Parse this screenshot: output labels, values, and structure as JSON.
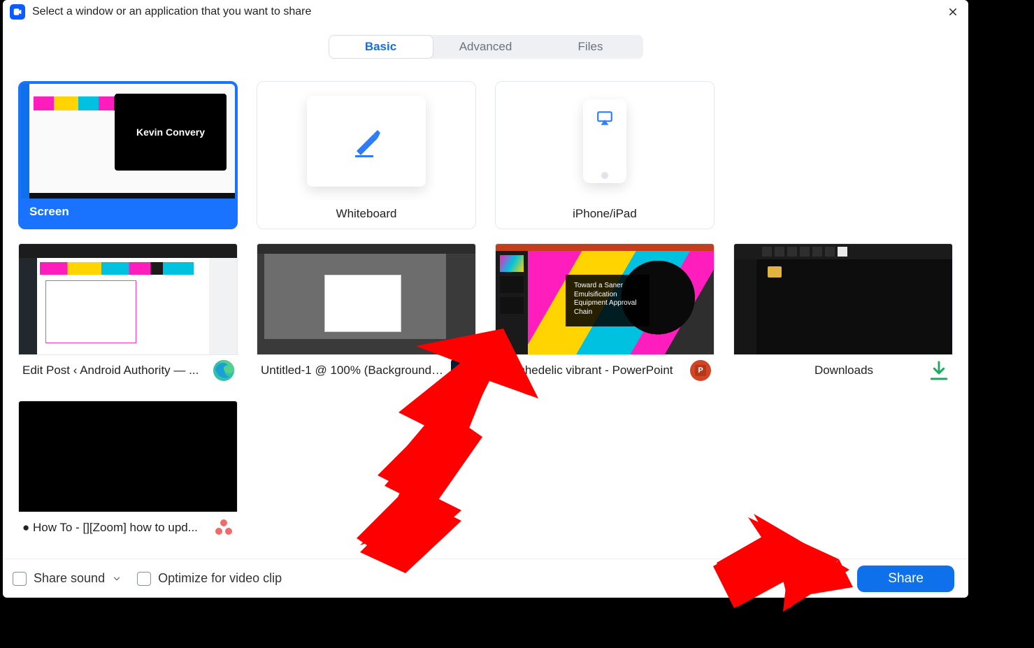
{
  "header": {
    "title": "Select a window or an application that you want to share"
  },
  "tabs": {
    "basic": "Basic",
    "advanced": "Advanced",
    "files": "Files",
    "active": "basic"
  },
  "cards": {
    "screen": {
      "label": "Screen",
      "overlay_name": "Kevin Convery"
    },
    "whiteboard": {
      "label": "Whiteboard"
    },
    "iphone": {
      "label": "iPhone/iPad"
    }
  },
  "windows": [
    {
      "label": "Edit Post ‹ Android Authority — ...",
      "app": "edge"
    },
    {
      "label": "Untitled-1 @ 100% (Background, ...",
      "app": "photoshop"
    },
    {
      "label": "Psychedelic vibrant - PowerPoint",
      "app": "powerpoint",
      "slide_text": "Toward a Saner Emulsification Equipment Approval Chain"
    },
    {
      "label": "Downloads",
      "app": "downloads"
    },
    {
      "label": "● How To - [][Zoom] how to upd...",
      "app": "asana"
    }
  ],
  "footer": {
    "share_sound": "Share sound",
    "optimize": "Optimize for video clip",
    "share_btn": "Share"
  }
}
